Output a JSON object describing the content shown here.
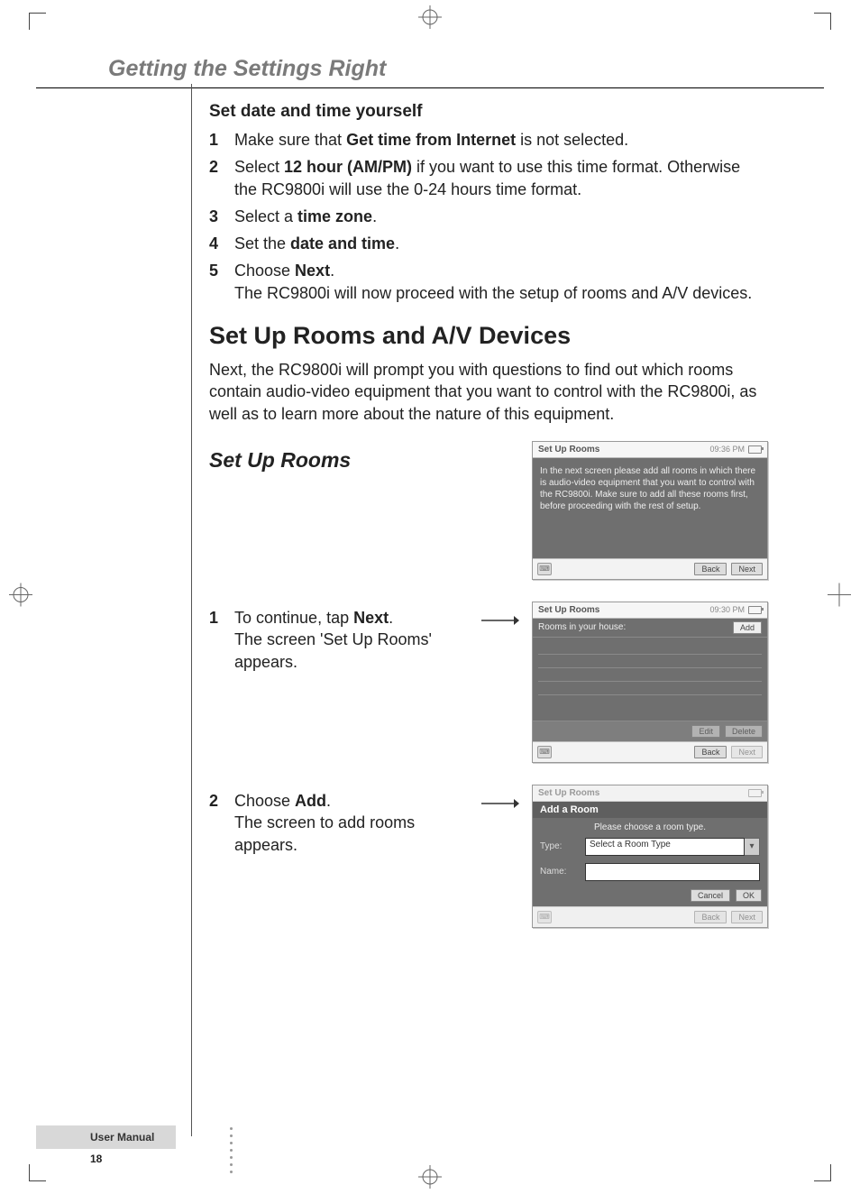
{
  "chapter": "Getting the Settings Right",
  "sections": {
    "set_date": {
      "title": "Set date and time yourself",
      "steps": [
        {
          "n": "1",
          "pre": "Make sure that ",
          "b": "Get time from Internet",
          "post": " is not selected."
        },
        {
          "n": "2",
          "pre": "Select ",
          "b": "12 hour (AM/PM)",
          "post": " if you want to use this time format. Otherwise the RC9800i will use the 0-24 hours time format."
        },
        {
          "n": "3",
          "pre": "Select a ",
          "b": "time zone",
          "post": "."
        },
        {
          "n": "4",
          "pre": "Set the ",
          "b": "date and time",
          "post": "."
        },
        {
          "n": "5",
          "pre": "Choose ",
          "b": "Next",
          "post": ".",
          "note": "The RC9800i will now proceed with the setup of rooms and A/V devices."
        }
      ]
    },
    "rooms_devices": {
      "title": "Set Up Rooms and A/V Devices",
      "intro": "Next, the RC9800i will prompt you with questions to find out which rooms contain audio-video equipment that you want to control with the RC9800i, as well as to learn more about the nature of this equipment."
    },
    "rooms": {
      "title": "Set Up Rooms",
      "step1_pre": "To continue, tap ",
      "step1_b": "Next",
      "step1_post": ".",
      "step1_note": "The screen 'Set Up Rooms' appears.",
      "step2_pre": "Choose ",
      "step2_b": "Add",
      "step2_post": ".",
      "step2_note": "The screen to add rooms appears."
    }
  },
  "screenshots": {
    "s1": {
      "title": "Set Up Rooms",
      "time": "09:36 PM",
      "body": "In the next screen please add all rooms in which there is audio-video equipment that you want to control with the RC9800i. Make sure to add all these rooms first, before proceeding with the rest of setup.",
      "back": "Back",
      "next": "Next"
    },
    "s2": {
      "title": "Set Up Rooms",
      "time": "09:30 PM",
      "subhead": "Rooms in your house:",
      "add": "Add",
      "edit": "Edit",
      "delete": "Delete",
      "back": "Back",
      "next": "Next"
    },
    "s3": {
      "title": "Set Up Rooms",
      "modal_title": "Add a Room",
      "hint": "Please choose a room type.",
      "type_label": "Type:",
      "name_label": "Name:",
      "type_value": "Select a Room Type",
      "cancel": "Cancel",
      "ok": "OK",
      "back": "Back",
      "next": "Next"
    }
  },
  "footer": {
    "label": "User Manual",
    "page": "18"
  }
}
